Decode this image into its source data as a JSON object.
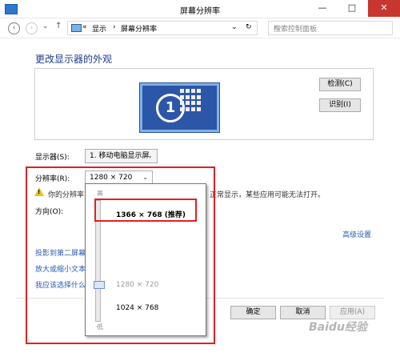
{
  "window": {
    "title": "屏幕分辨率",
    "minimize": "—",
    "maximize": "□",
    "close": "✕"
  },
  "address": {
    "back": "‹",
    "forward": "›",
    "up": "↑",
    "overflow": "«",
    "crumb1": "显示",
    "crumb2": "屏幕分辨率",
    "sep": "›",
    "dropdown": "⌄",
    "refresh": "↻",
    "search_placeholder": "搜索控制面板",
    "search_glyph": "⌕"
  },
  "main": {
    "heading": "更改显示器的外观",
    "monitor_number": "1",
    "detect_button": "检测(C)",
    "identify_button": "识别(I)",
    "display_label": "显示器(S):",
    "display_value": "1. 移动电脑显示屏",
    "resolution_label": "分辨率(R):",
    "resolution_value": "1280 × 720",
    "warning_start": "你的分辨率",
    "warning_end": "正常显示，某些应用可能无法打开。",
    "orientation_label": "方向(O):",
    "advanced_link": "高级设置",
    "link1": "投影到第二屏幕",
    "link2": "放大或缩小文本",
    "link3": "我应该选择什么"
  },
  "dropdown": {
    "high": "高",
    "low": "低",
    "option_recommended": "1366 × 768 (推荐)",
    "option_current": "1280 × 720",
    "option_other": "1024 × 768",
    "slider_level": 0.25
  },
  "footer": {
    "ok": "确定",
    "cancel": "取消",
    "apply": "应用(A)"
  },
  "watermark": "Baidu经验",
  "colors": {
    "accent": "#2c56a8",
    "highlight": "#e02020",
    "link": "#2a5db0"
  }
}
